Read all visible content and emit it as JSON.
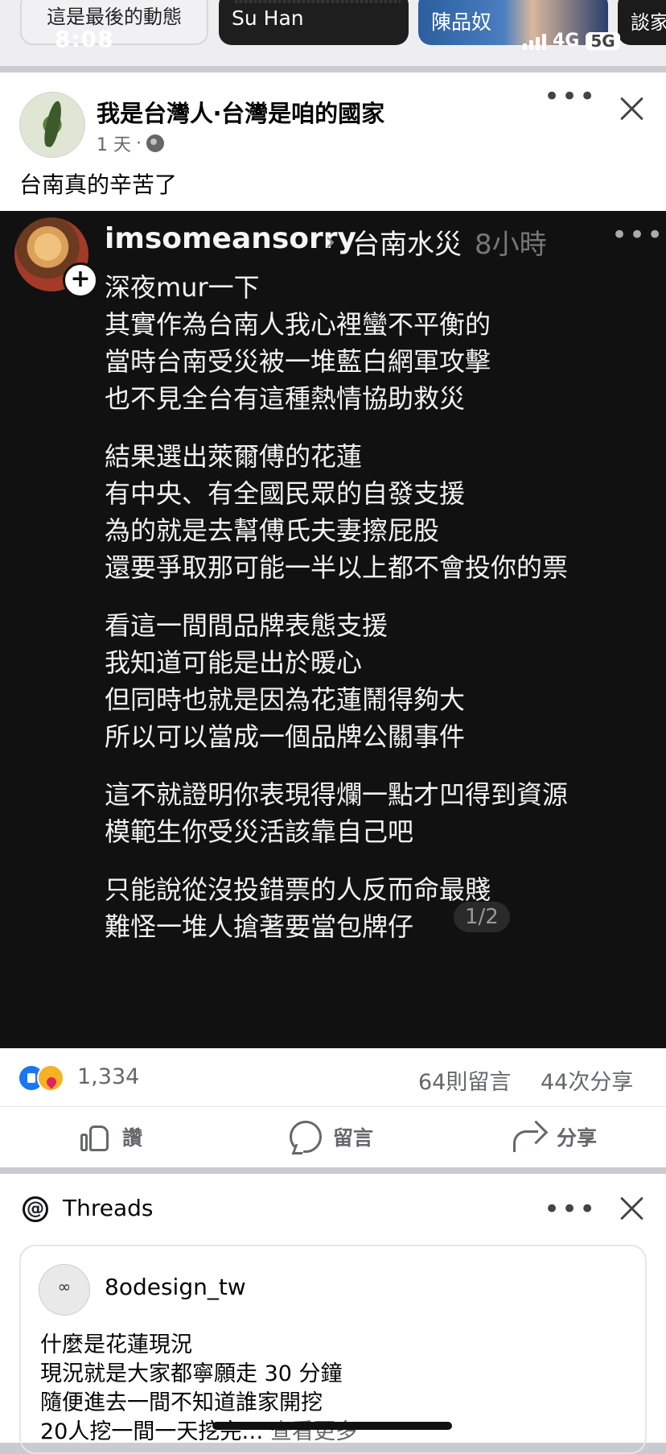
{
  "status": {
    "time": "8:08",
    "network_4g": "4G",
    "network_5g": "5G"
  },
  "stories": [
    {
      "label": "這是最後的動態"
    },
    {
      "label": "Su Han"
    },
    {
      "label": "陳品奴"
    },
    {
      "label": "談家"
    }
  ],
  "post1": {
    "page_name": "我是台灣人‧台灣是咱的國家",
    "age": "1 天",
    "dot": "·",
    "caption": "台南真的辛苦了",
    "embed": {
      "username": "imsomeansorry",
      "topic": "台南水災",
      "time": "8小時",
      "plus": "+",
      "lines": [
        "深夜mur一下",
        "其實作為台南人我心裡蠻不平衡的",
        "當時台南受災被一堆藍白網軍攻擊",
        "也不見全台有這種熱情協助救災",
        "結果選出萊爾傅的花蓮",
        "有中央、有全國民眾的自發支援",
        "為的就是去幫傅氏夫妻擦屁股",
        "還要爭取那可能一半以上都不會投你的票",
        "看這一間間品牌表態支援",
        "我知道可能是出於暖心",
        "但同時也就是因為花蓮鬧得夠大",
        "所以可以當成一個品牌公關事件",
        "這不就證明你表現得爛一點才凹得到資源",
        "模範生你受災活該靠自己吧",
        "只能說從沒投錯票的人反而命最賤",
        "難怪一堆人搶著要當包牌仔"
      ],
      "page_indicator": "1/2"
    },
    "reaction_count": "1,334",
    "comment_count": "64則留言",
    "share_count": "44次分享",
    "actions": {
      "like": "讚",
      "comment": "留言",
      "share": "分享"
    }
  },
  "post2": {
    "source": "Threads",
    "card": {
      "username": "8odesign_tw",
      "avatar_text": "∞",
      "lines": [
        "什麼是花蓮現況",
        "現況就是大家都寧願走 30 分鐘",
        "隨便進去一間不知道誰家開挖"
      ],
      "last_line": "20人挖一間一天挖完…",
      "see_more": "查看更多"
    }
  }
}
